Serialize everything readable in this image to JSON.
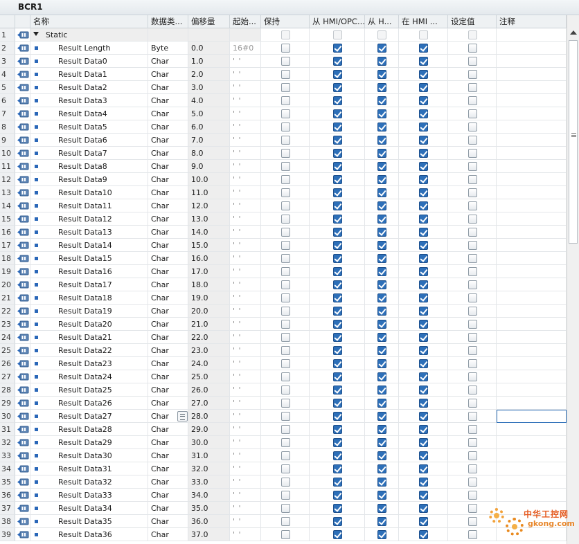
{
  "window": {
    "title": "BCR1"
  },
  "columns": {
    "name": "名称",
    "datatype": "数据类...",
    "offset": "偏移量",
    "start": "起始...",
    "retain": "保持",
    "hmi_access": "从 HMI/OPC...",
    "hmi_write": "从 H...",
    "hmi_visible": "在 HMI ...",
    "setpoint": "设定值",
    "comment": "注释"
  },
  "rows": [
    {
      "num": "1",
      "name": "Static",
      "type": "",
      "offset": "",
      "start": "",
      "section": true
    },
    {
      "num": "2",
      "name": "Result Length",
      "type": "Byte",
      "offset": "0.0",
      "start": "16#0"
    },
    {
      "num": "3",
      "name": "Result Data0",
      "type": "Char",
      "offset": "1.0",
      "start": "' '"
    },
    {
      "num": "4",
      "name": "Result Data1",
      "type": "Char",
      "offset": "2.0",
      "start": "' '"
    },
    {
      "num": "5",
      "name": "Result Data2",
      "type": "Char",
      "offset": "3.0",
      "start": "' '"
    },
    {
      "num": "6",
      "name": "Result Data3",
      "type": "Char",
      "offset": "4.0",
      "start": "' '"
    },
    {
      "num": "7",
      "name": "Result Data4",
      "type": "Char",
      "offset": "5.0",
      "start": "' '"
    },
    {
      "num": "8",
      "name": "Result Data5",
      "type": "Char",
      "offset": "6.0",
      "start": "' '"
    },
    {
      "num": "9",
      "name": "Result Data6",
      "type": "Char",
      "offset": "7.0",
      "start": "' '"
    },
    {
      "num": "10",
      "name": "Result Data7",
      "type": "Char",
      "offset": "8.0",
      "start": "' '"
    },
    {
      "num": "11",
      "name": "Result Data8",
      "type": "Char",
      "offset": "9.0",
      "start": "' '"
    },
    {
      "num": "12",
      "name": "Result Data9",
      "type": "Char",
      "offset": "10.0",
      "start": "' '"
    },
    {
      "num": "13",
      "name": "Result Data10",
      "type": "Char",
      "offset": "11.0",
      "start": "' '"
    },
    {
      "num": "14",
      "name": "Result Data11",
      "type": "Char",
      "offset": "12.0",
      "start": "' '"
    },
    {
      "num": "15",
      "name": "Result Data12",
      "type": "Char",
      "offset": "13.0",
      "start": "' '"
    },
    {
      "num": "16",
      "name": "Result Data13",
      "type": "Char",
      "offset": "14.0",
      "start": "' '"
    },
    {
      "num": "17",
      "name": "Result Data14",
      "type": "Char",
      "offset": "15.0",
      "start": "' '"
    },
    {
      "num": "18",
      "name": "Result Data15",
      "type": "Char",
      "offset": "16.0",
      "start": "' '"
    },
    {
      "num": "19",
      "name": "Result Data16",
      "type": "Char",
      "offset": "17.0",
      "start": "' '"
    },
    {
      "num": "20",
      "name": "Result Data17",
      "type": "Char",
      "offset": "18.0",
      "start": "' '"
    },
    {
      "num": "21",
      "name": "Result Data18",
      "type": "Char",
      "offset": "19.0",
      "start": "' '"
    },
    {
      "num": "22",
      "name": "Result Data19",
      "type": "Char",
      "offset": "20.0",
      "start": "' '"
    },
    {
      "num": "23",
      "name": "Result Data20",
      "type": "Char",
      "offset": "21.0",
      "start": "' '"
    },
    {
      "num": "24",
      "name": "Result Data21",
      "type": "Char",
      "offset": "22.0",
      "start": "' '"
    },
    {
      "num": "25",
      "name": "Result Data22",
      "type": "Char",
      "offset": "23.0",
      "start": "' '"
    },
    {
      "num": "26",
      "name": "Result Data23",
      "type": "Char",
      "offset": "24.0",
      "start": "' '"
    },
    {
      "num": "27",
      "name": "Result Data24",
      "type": "Char",
      "offset": "25.0",
      "start": "' '"
    },
    {
      "num": "28",
      "name": "Result Data25",
      "type": "Char",
      "offset": "26.0",
      "start": "' '"
    },
    {
      "num": "29",
      "name": "Result Data26",
      "type": "Char",
      "offset": "27.0",
      "start": "' '"
    },
    {
      "num": "30",
      "name": "Result Data27",
      "type": "Char",
      "offset": "28.0",
      "start": "' '",
      "selected": true
    },
    {
      "num": "31",
      "name": "Result Data28",
      "type": "Char",
      "offset": "29.0",
      "start": "' '"
    },
    {
      "num": "32",
      "name": "Result Data29",
      "type": "Char",
      "offset": "30.0",
      "start": "' '"
    },
    {
      "num": "33",
      "name": "Result Data30",
      "type": "Char",
      "offset": "31.0",
      "start": "' '"
    },
    {
      "num": "34",
      "name": "Result Data31",
      "type": "Char",
      "offset": "32.0",
      "start": "' '"
    },
    {
      "num": "35",
      "name": "Result Data32",
      "type": "Char",
      "offset": "33.0",
      "start": "' '"
    },
    {
      "num": "36",
      "name": "Result Data33",
      "type": "Char",
      "offset": "34.0",
      "start": "' '"
    },
    {
      "num": "37",
      "name": "Result Data34",
      "type": "Char",
      "offset": "35.0",
      "start": "' '"
    },
    {
      "num": "38",
      "name": "Result Data35",
      "type": "Char",
      "offset": "36.0",
      "start": "' '"
    },
    {
      "num": "39",
      "name": "Result Data36",
      "type": "Char",
      "offset": "37.0",
      "start": "' '"
    }
  ],
  "icons": {
    "interface": "db-interface-icon",
    "member": "member-icon",
    "expander": "expand-triangle-icon",
    "ellipsis": "list-picker-icon"
  },
  "colors": {
    "checkbox_checked": "#2d6fb8",
    "selection_border": "#2d6fb8"
  },
  "watermark": {
    "cn": "中华工控网",
    "en": "gkong.com"
  }
}
